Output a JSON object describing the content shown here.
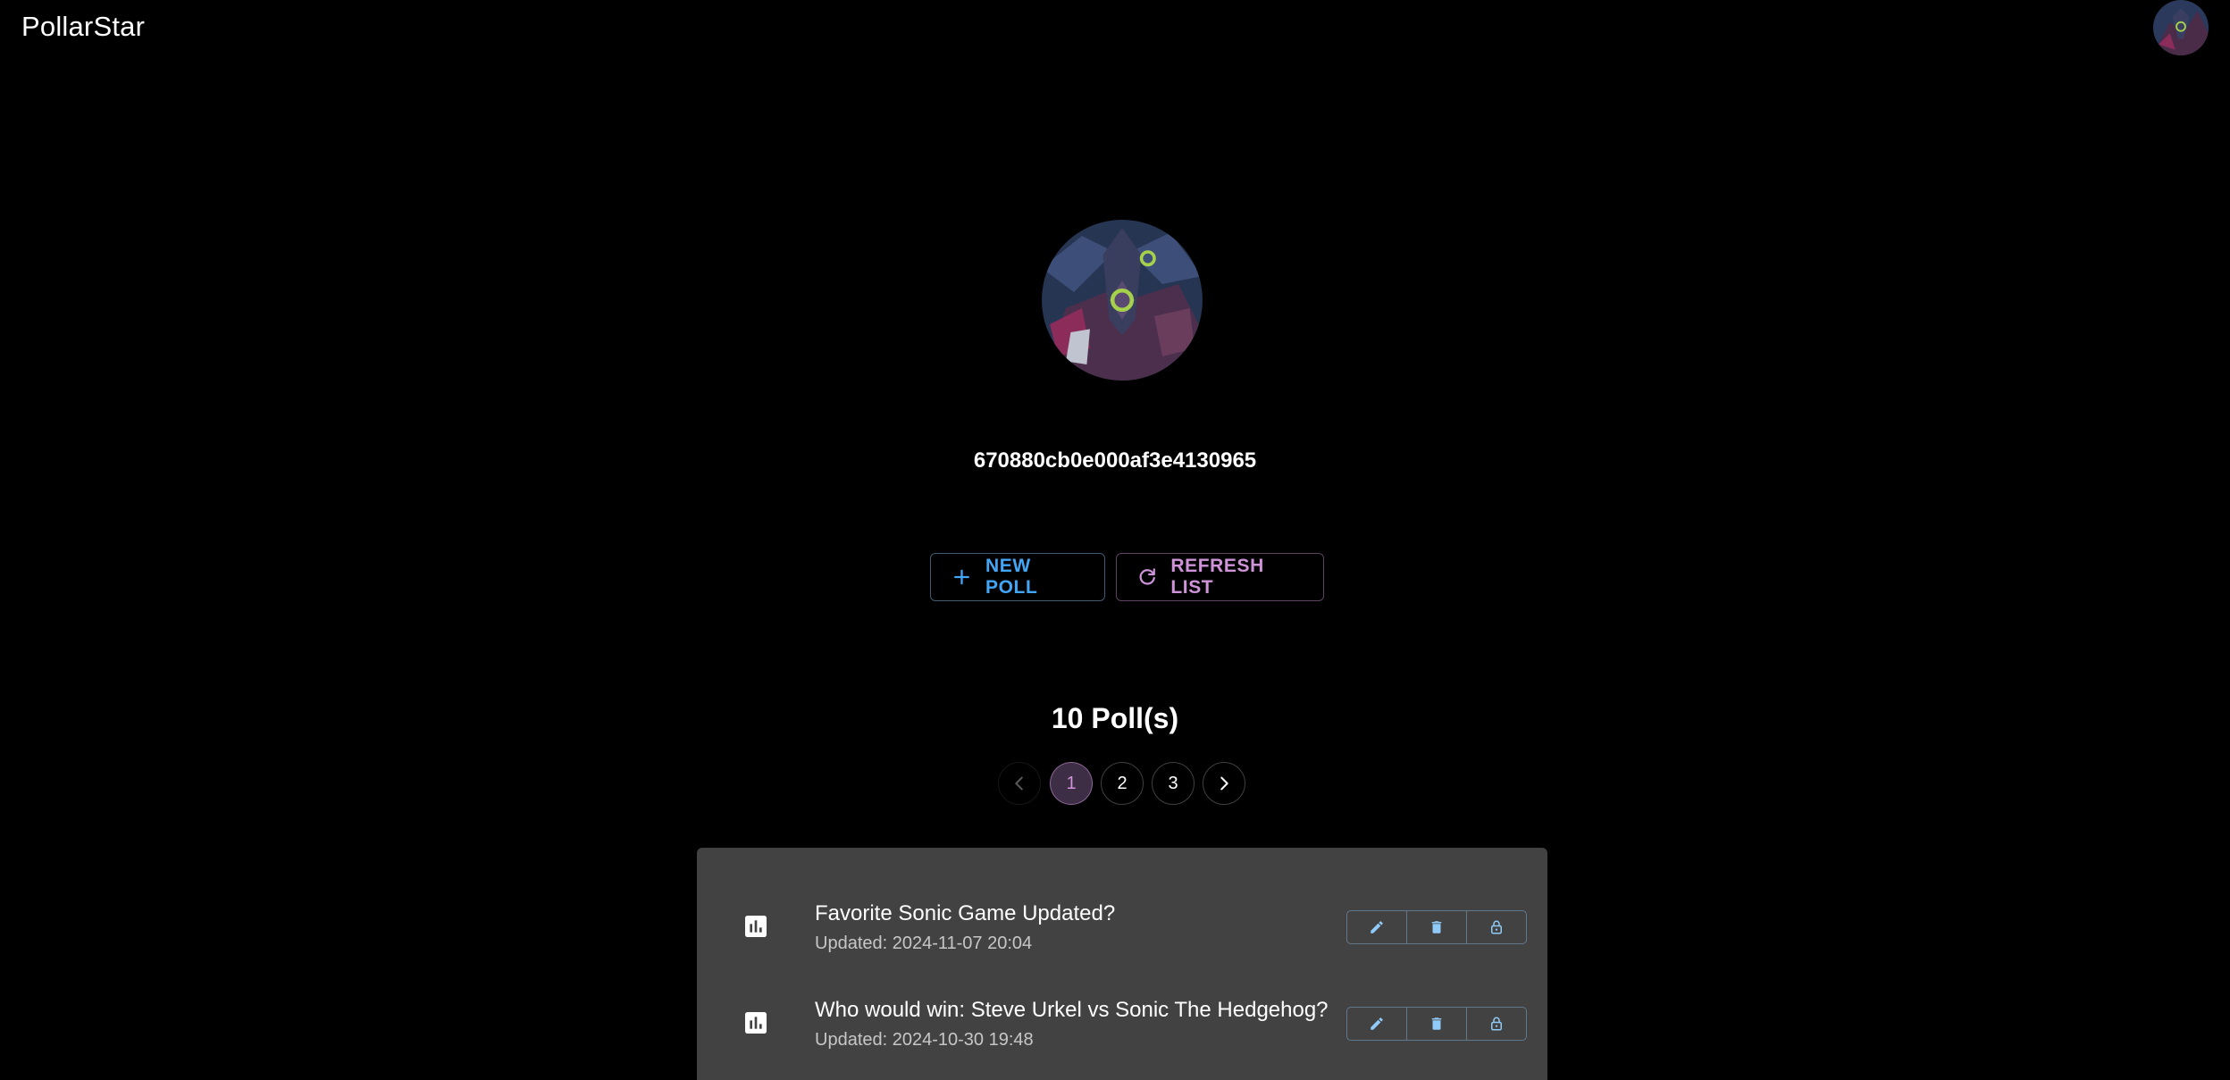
{
  "header": {
    "title": "PollarStar"
  },
  "profile": {
    "user_id": "670880cb0e000af3e4130965"
  },
  "actions": {
    "new_poll_label": "NEW POLL",
    "refresh_label": "REFRESH LIST"
  },
  "polls": {
    "count_label": "10 Poll(s)",
    "pagination": {
      "pages": [
        "1",
        "2",
        "3"
      ],
      "current": "1"
    },
    "items": [
      {
        "title": "Favorite Sonic Game Updated?",
        "updated": "Updated: 2024-11-07 20:04"
      },
      {
        "title": "Who would win: Steve Urkel vs Sonic The Hedgehog?",
        "updated": "Updated: 2024-10-30 19:48"
      }
    ]
  },
  "colors": {
    "accent_blue": "#42a5f5",
    "accent_purple": "#ce93d8",
    "panel": "#424242",
    "background": "#000000"
  },
  "icons": [
    "avatar",
    "plus-icon",
    "refresh-icon",
    "chevron-left-icon",
    "chevron-right-icon",
    "bar-chart-icon",
    "edit-icon",
    "delete-icon",
    "lock-icon"
  ]
}
